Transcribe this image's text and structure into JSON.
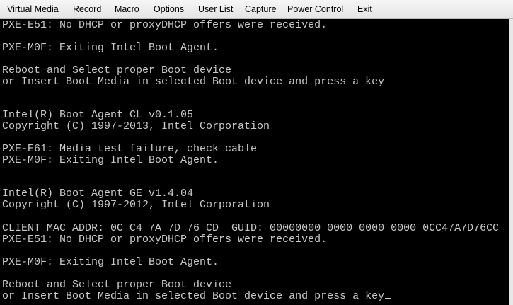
{
  "menu": [
    "Virtual Media",
    "Record",
    "Macro",
    "Options",
    "User List",
    "Capture",
    "Power Control",
    "Exit"
  ],
  "console": {
    "lines": [
      "PXE-E51: No DHCP or proxyDHCP offers were received.",
      "",
      "PXE-M0F: Exiting Intel Boot Agent.",
      "",
      "Reboot and Select proper Boot device",
      "or Insert Boot Media in selected Boot device and press a key",
      "",
      "",
      "Intel(R) Boot Agent CL v0.1.05",
      "Copyright (C) 1997-2013, Intel Corporation",
      "",
      "PXE-E61: Media test failure, check cable",
      "PXE-M0F: Exiting Intel Boot Agent.",
      "",
      "",
      "Intel(R) Boot Agent GE v1.4.04",
      "Copyright (C) 1997-2012, Intel Corporation",
      "",
      "CLIENT MAC ADDR: 0C C4 7A 7D 76 CD  GUID: 00000000 0000 0000 0000 0CC47A7D76CC",
      "PXE-E51: No DHCP or proxyDHCP offers were received.",
      "",
      "PXE-M0F: Exiting Intel Boot Agent.",
      "",
      "Reboot and Select proper Boot device",
      "or Insert Boot Media in selected Boot device and press a key"
    ]
  },
  "colors": {
    "console_bg": "#000000",
    "console_text": "#c8c8c8",
    "menubar_bg": "#ececec"
  }
}
